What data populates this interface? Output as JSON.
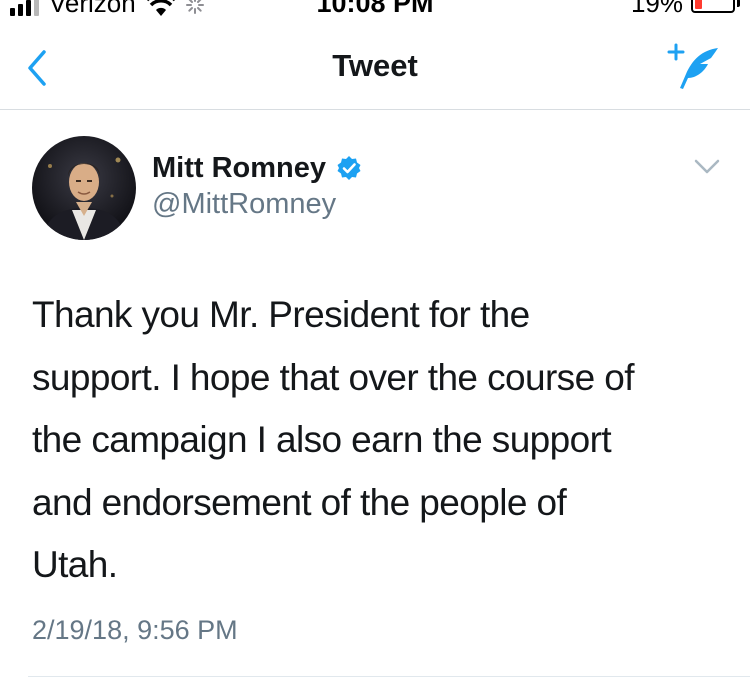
{
  "status_bar": {
    "carrier": "Verizon",
    "time": "10:08 PM",
    "battery_percent": "19%",
    "battery_level": 0.19,
    "battery_color": "#ff3b30",
    "icons": [
      "signal-icon",
      "wifi-icon",
      "activity-spinner-icon",
      "battery-icon"
    ]
  },
  "nav": {
    "title": "Tweet",
    "back_icon": "chevron-left-icon",
    "compose_icon": "compose-tweet-icon",
    "accent_color": "#1da1f2"
  },
  "tweet": {
    "author_name": "Mitt Romney",
    "author_handle": "@MittRomney",
    "verified": true,
    "text": "Thank you Mr. President for the\nsupport. I hope that over the course of\nthe campaign I also earn the support\nand endorsement of the people of\nUtah.",
    "timestamp": "2/19/18, 9:56 PM"
  }
}
